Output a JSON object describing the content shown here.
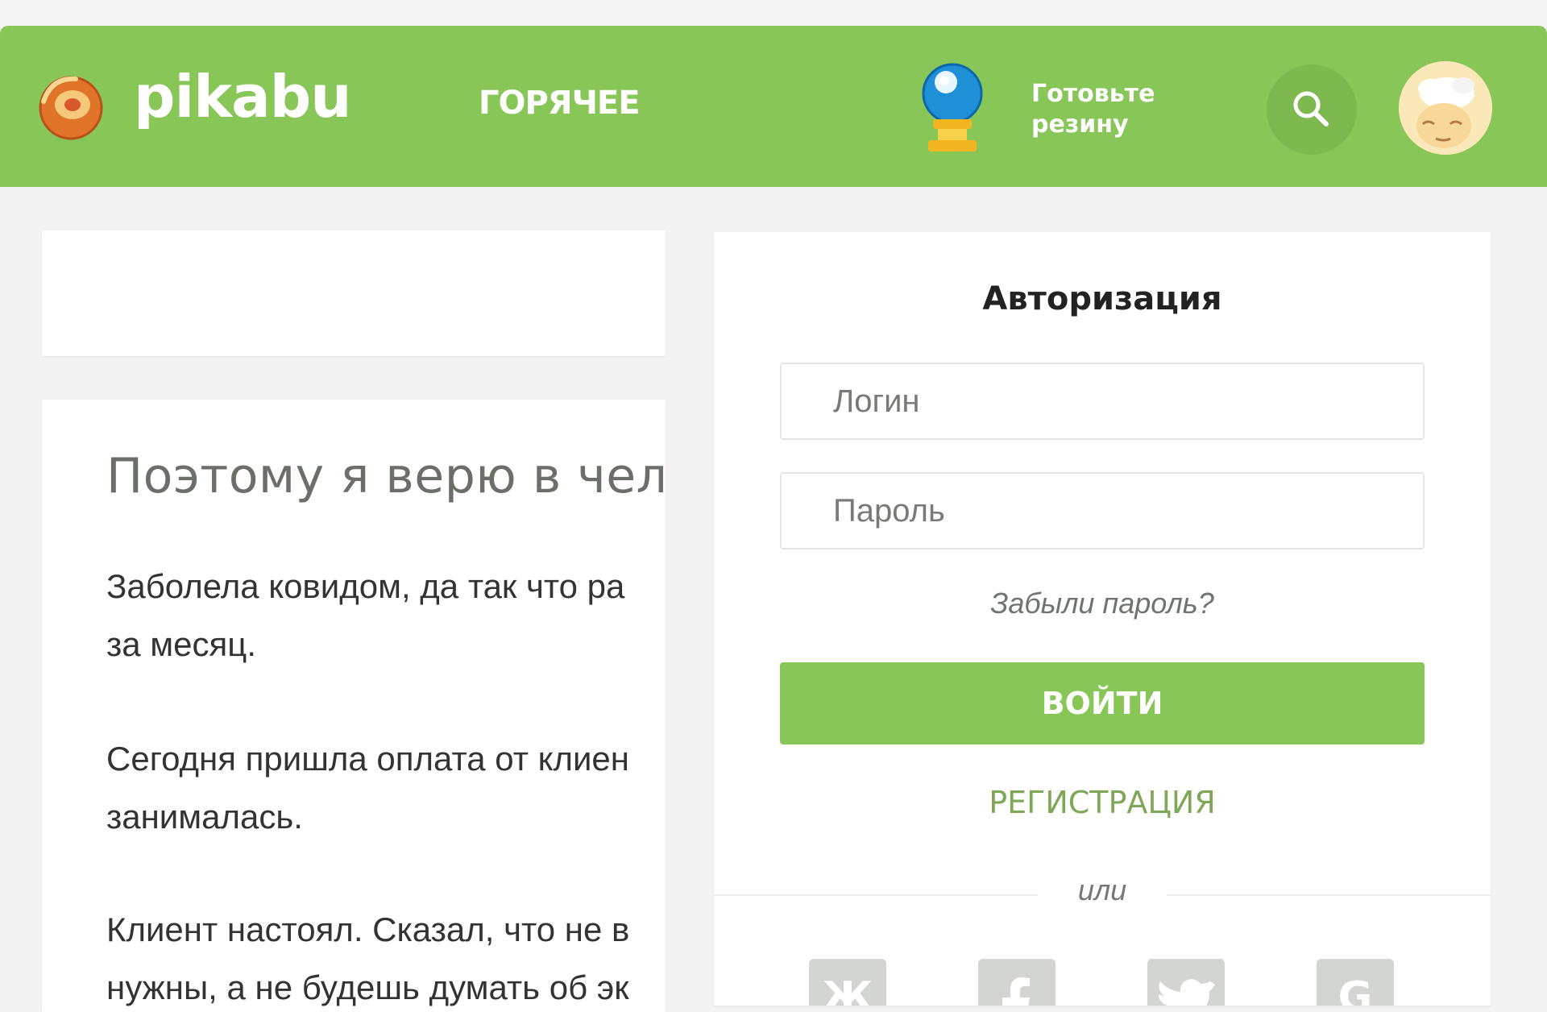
{
  "header": {
    "brand": "pikabu",
    "nav_hot": "ГОРЯЧЕЕ",
    "promo_text": "Готовьте резину",
    "icons": {
      "logo": "pikabu-logo-icon",
      "promo": "crystal-ball-icon",
      "search": "search-icon",
      "avatar": "avatar"
    },
    "colors": {
      "accent": "#88c657",
      "search_bg": "#7eb94f"
    }
  },
  "post": {
    "title": "Поэтому я верю в чело",
    "paragraphs": [
      "Заболела ковидом, да так что ра\nза месяц.",
      "Сегодня пришла оплата от клиен\nзанималась.",
      "Клиент настоял. Сказал, что не в\nнужны, а не будешь думать об эк"
    ]
  },
  "auth": {
    "title": "Авторизация",
    "login_placeholder": "Логин",
    "password_placeholder": "Пароль",
    "forgot": "Забыли пароль?",
    "login_button": "ВОЙТИ",
    "register": "РЕГИСТРАЦИЯ",
    "or": "или",
    "social": [
      {
        "icon": "vk-icon",
        "label": "Ж"
      },
      {
        "icon": "facebook-icon",
        "label": ""
      },
      {
        "icon": "twitter-icon",
        "label": ""
      },
      {
        "icon": "google-icon",
        "label": "G"
      }
    ],
    "colors": {
      "button": "#88c657",
      "register": "#7ea857",
      "social_bg": "#d2d5d2"
    }
  }
}
